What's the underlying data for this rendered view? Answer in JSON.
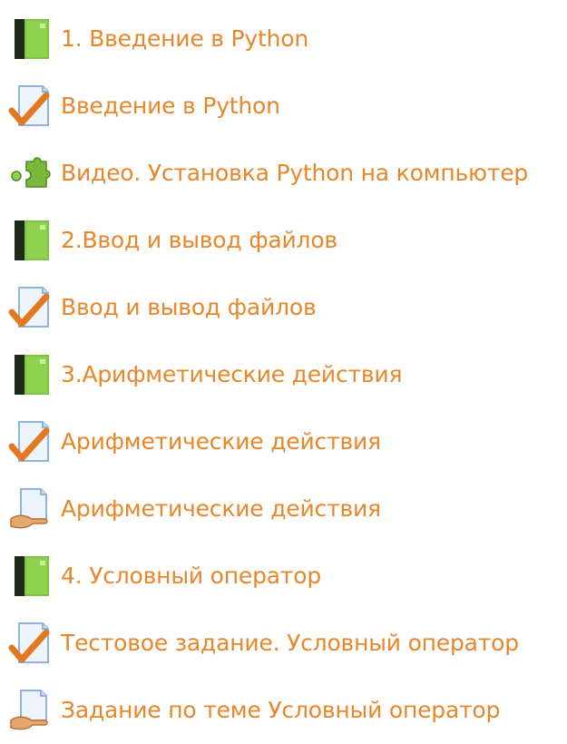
{
  "accent_color": "#e8862a",
  "activities": [
    {
      "type": "book",
      "icon": "book-icon",
      "label": "1. Введение в Python"
    },
    {
      "type": "quiz",
      "icon": "quiz-icon",
      "label": "Введение в Python"
    },
    {
      "type": "lti",
      "icon": "puzzle-icon",
      "label": "Видео. Установка Python на компьютер"
    },
    {
      "type": "book",
      "icon": "book-icon",
      "label": "2.Ввод и вывод файлов"
    },
    {
      "type": "quiz",
      "icon": "quiz-icon",
      "label": "Ввод и вывод файлов"
    },
    {
      "type": "book",
      "icon": "book-icon",
      "label": "3.Арифметические действия"
    },
    {
      "type": "quiz",
      "icon": "quiz-icon",
      "label": "Арифметические действия"
    },
    {
      "type": "assignment",
      "icon": "assignment-icon",
      "label": "Арифметические действия"
    },
    {
      "type": "book",
      "icon": "book-icon",
      "label": "4. Условный оператор"
    },
    {
      "type": "quiz",
      "icon": "quiz-icon",
      "label": "Тестовое задание. Условный оператор"
    },
    {
      "type": "assignment",
      "icon": "assignment-icon",
      "label": "Задание по теме Условный оператор"
    }
  ]
}
